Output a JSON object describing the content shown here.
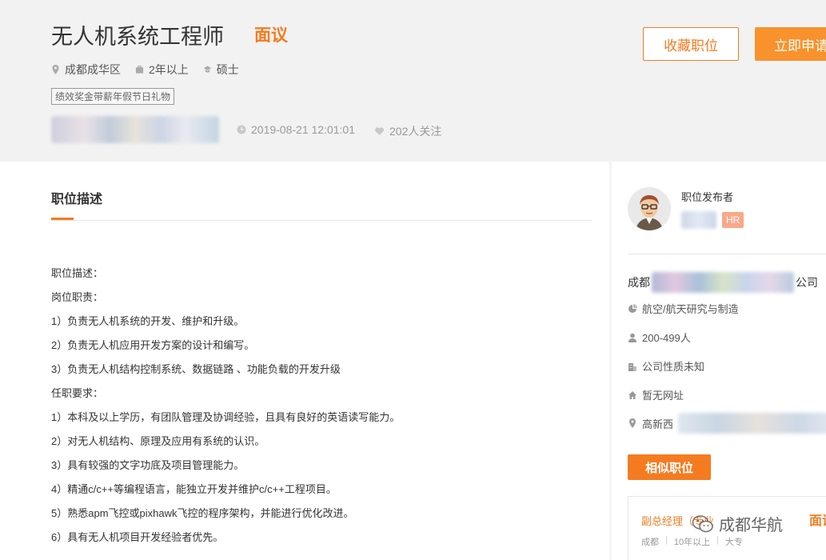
{
  "job": {
    "title": "无人机系统工程师",
    "salary": "面议",
    "location": "成都成华区",
    "experience": "2年以上",
    "education": "硕士",
    "benefits_tag": "绩效奖金带薪年假节日礼物",
    "publish_time": "2019-08-21 12:01:01",
    "followers": "202人关注"
  },
  "actions": {
    "favorite": "收藏职位",
    "apply": "立即申请"
  },
  "description": {
    "section_title": "职位描述",
    "lines": [
      "职位描述：",
      "岗位职责：",
      "1）负责无人机系统的开发、维护和升级。",
      "2）负责无人机应用开发方案的设计和编写。",
      "3）负责无人机结构控制系统、数据链路 、功能负载的开发升级",
      "任职要求：",
      "1）本科及以上学历，有团队管理及协调经验，且具有良好的英语读写能力。",
      "2）对无人机结构、原理及应用有系统的认识。",
      "3）具有较强的文字功底及项目管理能力。",
      "4）精通c/c++等编程语言，能独立开发并维护c/c++工程项目。",
      "5）熟悉apm飞控或pixhawk飞控的程序架构，并能进行优化改进。",
      "6）具有无人机项目开发经验者优先。"
    ]
  },
  "sidebar": {
    "publisher_label": "职位发布者",
    "hr_badge": "HR",
    "company_prefix": "成都",
    "company_suffix": "公司",
    "industry": "航空/航天研究与制造",
    "size": "200-499人",
    "nature": "公司性质未知",
    "website": "暂无网址",
    "address_prefix": "高新西",
    "similar_button": "相似职位"
  },
  "similar_job": {
    "title": "副总经理（专业",
    "salary": "面议",
    "city": "成都",
    "experience": "10年以上",
    "education": "大专"
  },
  "watermark": {
    "text": "成都华航"
  },
  "colors": {
    "accent": "#f47b20",
    "apply_button": "#f8922c",
    "hr_badge": "#f8a98a",
    "header_bg": "#f2f2f2"
  }
}
